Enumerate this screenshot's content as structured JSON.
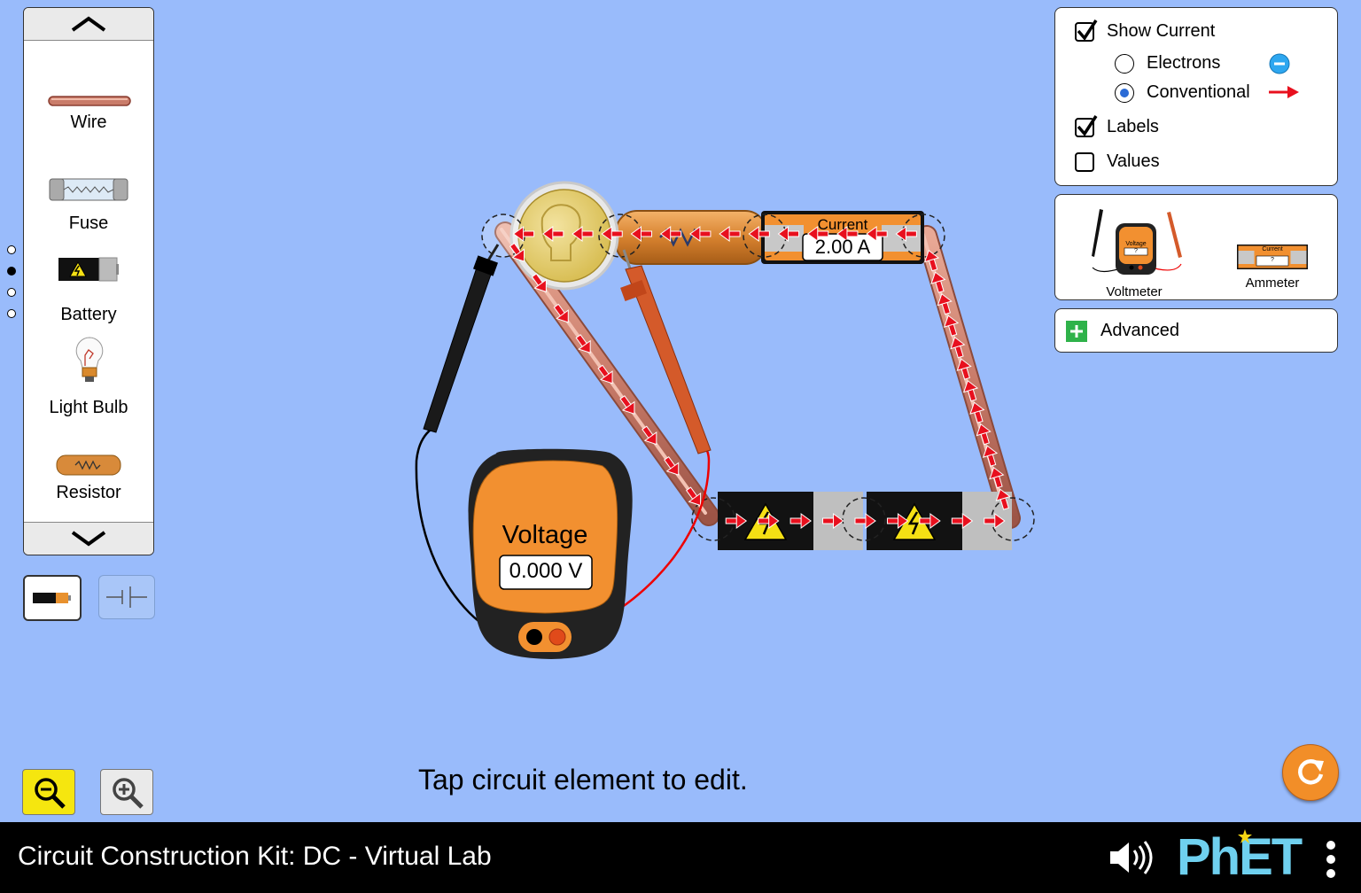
{
  "carousel": {
    "items": [
      {
        "label": "Wire",
        "icon": "wire-icon"
      },
      {
        "label": "Fuse",
        "icon": "fuse-icon"
      },
      {
        "label": "Battery",
        "icon": "battery-icon"
      },
      {
        "label": "Light Bulb",
        "icon": "light-bulb-icon"
      },
      {
        "label": "Resistor",
        "icon": "resistor-icon"
      }
    ],
    "page_count": 4,
    "active_page": 2
  },
  "view_type": {
    "options": [
      "lifelike",
      "schematic"
    ],
    "selected": "lifelike"
  },
  "display_panel": {
    "show_current": {
      "label": "Show Current",
      "checked": true
    },
    "electrons": {
      "label": "Electrons",
      "selected": false
    },
    "conventional": {
      "label": "Conventional",
      "selected": true
    },
    "labels": {
      "label": "Labels",
      "checked": true
    },
    "values": {
      "label": "Values",
      "checked": false
    }
  },
  "sensor_toolbox": {
    "voltmeter_label": "Voltmeter",
    "ammeter_label": "Ammeter",
    "voltmeter_icon_text": "Voltage",
    "ammeter_icon_text": "Current",
    "icon_reading": "?"
  },
  "advanced": {
    "label": "Advanced"
  },
  "ammeter": {
    "label": "Current",
    "reading": "2.00 A"
  },
  "voltmeter": {
    "label": "Voltage",
    "reading": "0.000 V"
  },
  "status_text": "Tap circuit element to edit.",
  "sim_title": "Circuit Construction Kit: DC - Virtual Lab",
  "brand": "PhET",
  "colors": {
    "background": "#99bbfb",
    "current_arrow": "#e8101e",
    "meter_orange": "#f29030",
    "accent_blue": "#2b6bd6"
  }
}
